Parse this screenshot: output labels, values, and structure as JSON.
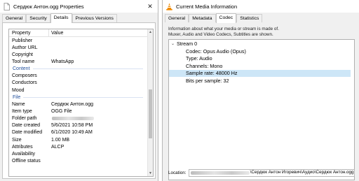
{
  "props_window": {
    "title": "Сердюк Антон.ogg Properties",
    "tabs": [
      "General",
      "Security",
      "Details",
      "Previous Versions"
    ],
    "active_tab": "Details",
    "columns": {
      "property": "Property",
      "value": "Value"
    },
    "rows_top": [
      {
        "key": "Publisher",
        "value": ""
      },
      {
        "key": "Author URL",
        "value": ""
      },
      {
        "key": "Copyright",
        "value": ""
      },
      {
        "key": "Tool name",
        "value": "WhatsApp"
      }
    ],
    "group_content": "Content",
    "rows_content": [
      {
        "key": "Composers",
        "value": ""
      },
      {
        "key": "Conductors",
        "value": ""
      },
      {
        "key": "Mood",
        "value": ""
      }
    ],
    "group_file": "File",
    "rows_file": [
      {
        "key": "Name",
        "value": "Сердюк Антон.ogg"
      },
      {
        "key": "Item type",
        "value": "OGG File"
      },
      {
        "key": "Folder path",
        "value": ""
      },
      {
        "key": "Date created",
        "value": "5/6/2021 10:58 PM"
      },
      {
        "key": "Date modified",
        "value": "6/1/2020 10:49 AM"
      },
      {
        "key": "Size",
        "value": "1.00 MB"
      },
      {
        "key": "Attributes",
        "value": "ALCP"
      },
      {
        "key": "Availability",
        "value": ""
      },
      {
        "key": "Offline status",
        "value": ""
      }
    ],
    "scroll_position": 0.62,
    "scroll_thumb_fraction": 0.36
  },
  "media_window": {
    "title": "Current Media Information",
    "tabs": [
      "General",
      "Metadata",
      "Codec",
      "Statistics"
    ],
    "active_tab": "Codec",
    "info_line1": "Information about what your media or stream is made of.",
    "info_line2": "Muxer, Audio and Video Codecs, Subtitles are shown.",
    "stream_label": "Stream 0",
    "stream_fields": [
      {
        "text": "Codec: Opus Audio (Opus)",
        "selected": false
      },
      {
        "text": "Type: Audio",
        "selected": false
      },
      {
        "text": "Channels: Mono",
        "selected": false
      },
      {
        "text": "Sample rate: 48000 Hz",
        "selected": true
      },
      {
        "text": "Bits per sample: 32",
        "selected": false
      }
    ],
    "location_label": "Location:",
    "location_value_visible": "\\Сердюк Антон Игоревич\\Аудио\\Сердюк Антон.ogg"
  },
  "colors": {
    "selection": "#cde6f7",
    "group_header": "#1f4e9b",
    "vlc_orange": "#f08a00"
  }
}
